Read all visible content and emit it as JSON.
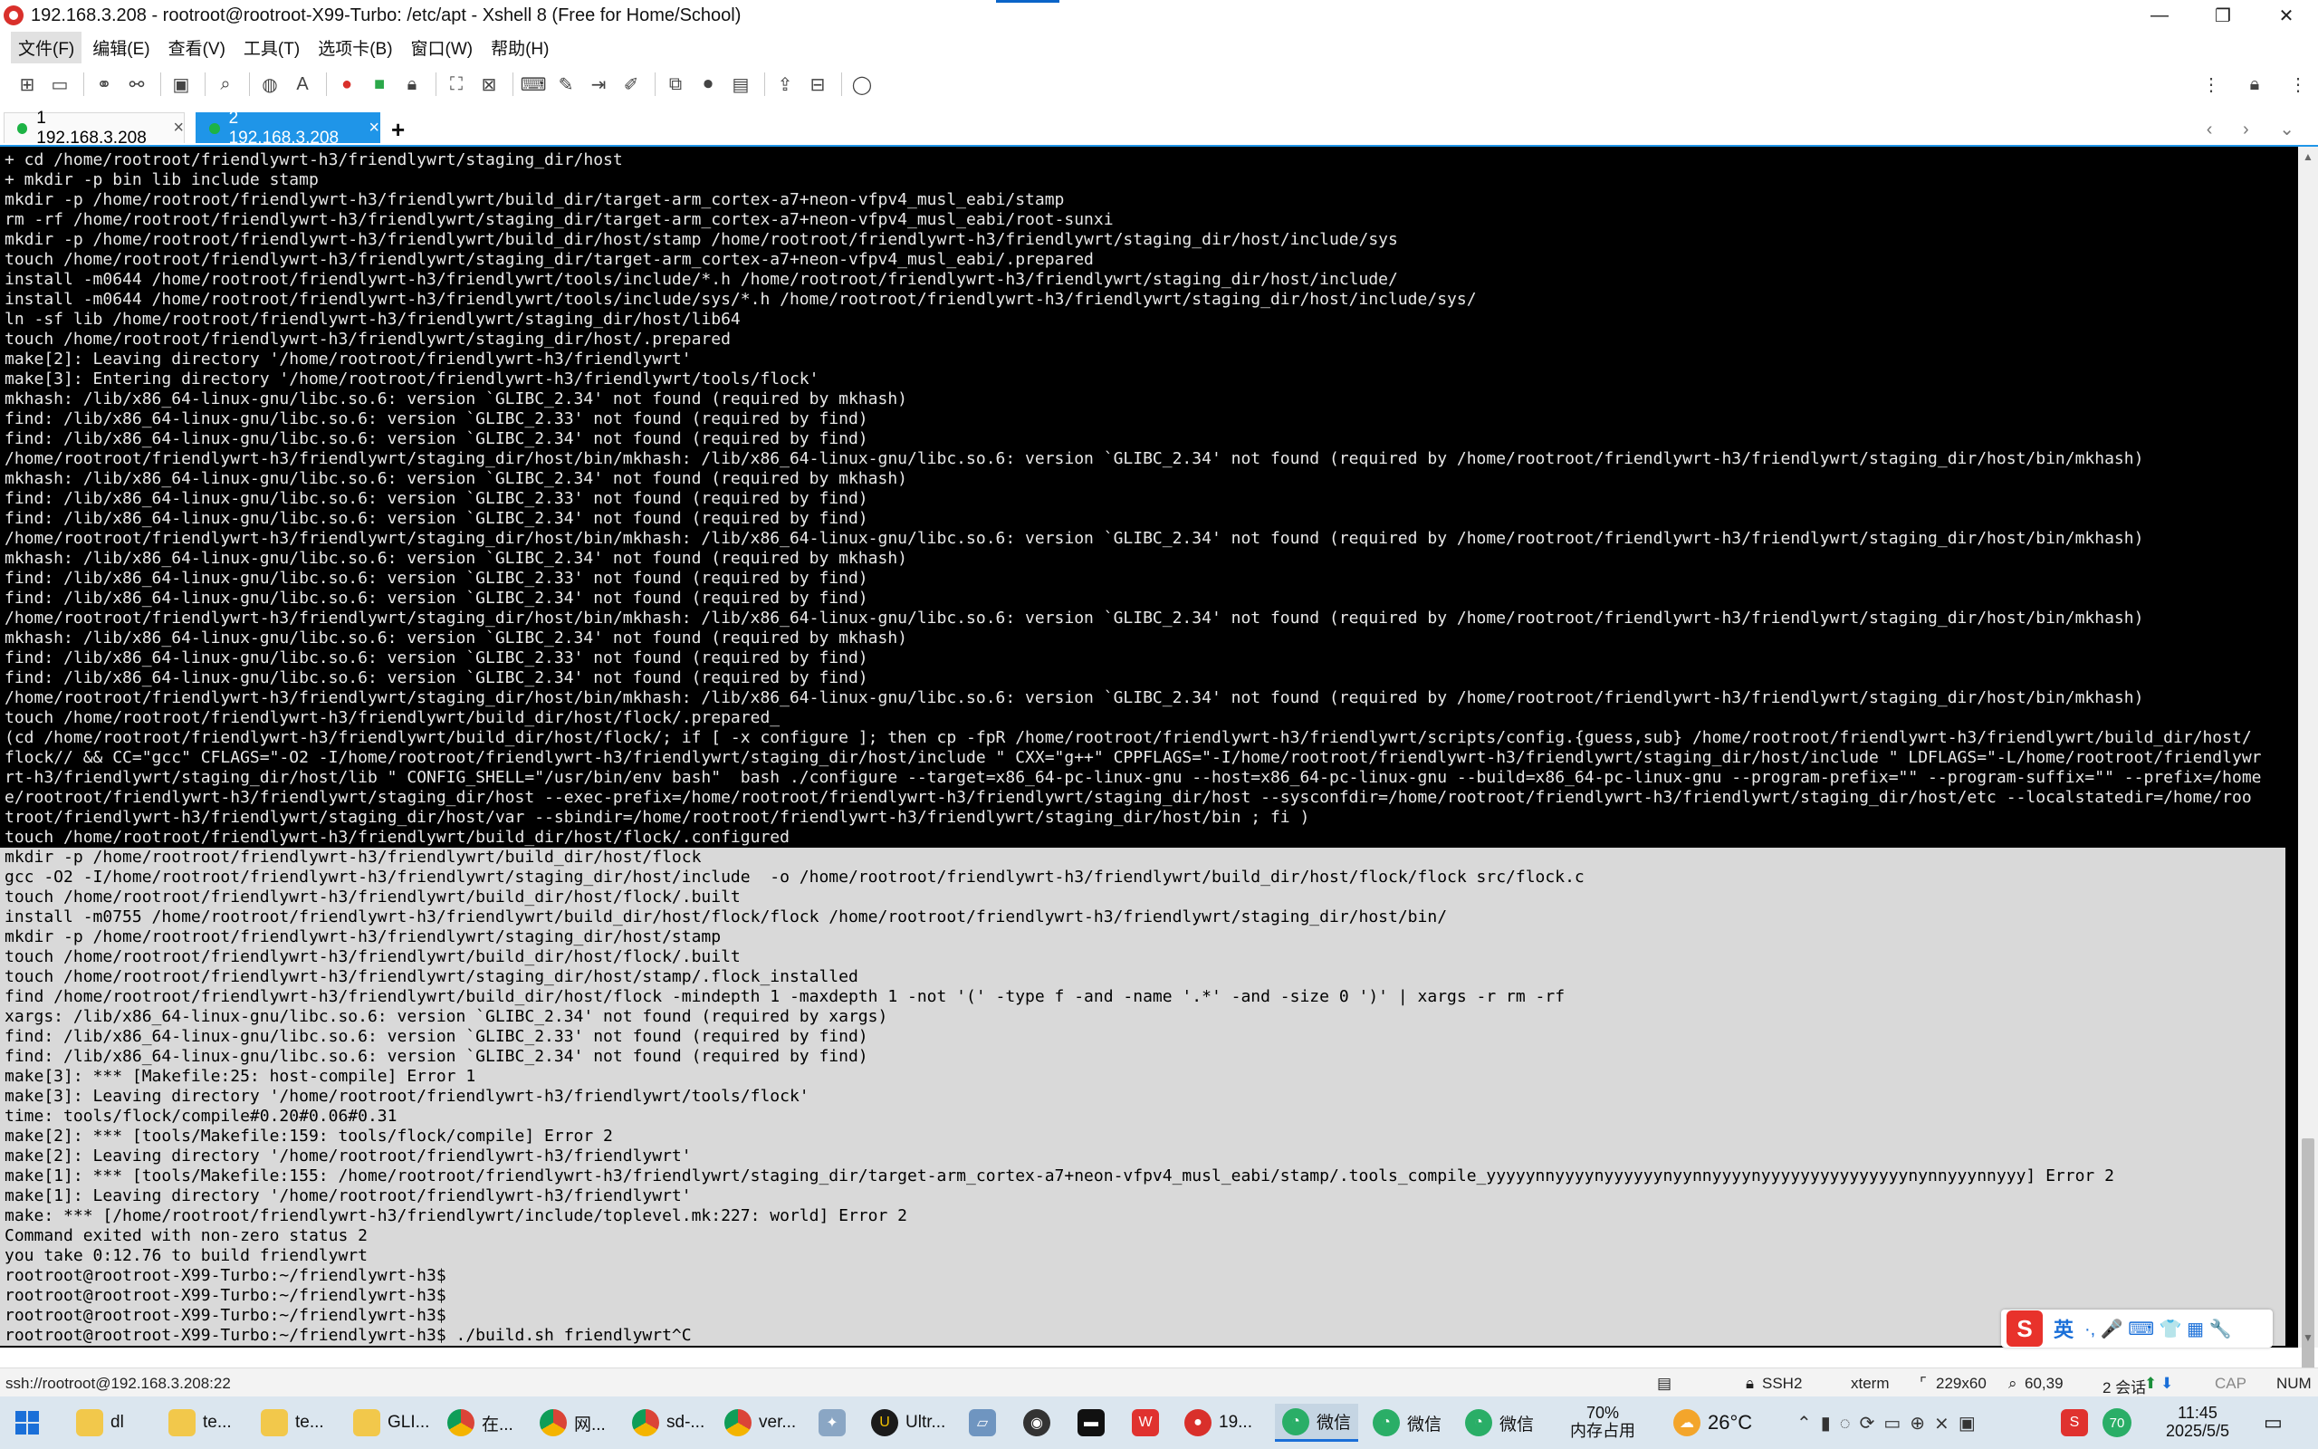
{
  "window": {
    "title": "192.168.3.208 - rootroot@rootroot-X99-Turbo: /etc/apt - Xshell 8 (Free for Home/School)",
    "controls": {
      "minimize": "—",
      "maximize": "❐",
      "close": "✕"
    }
  },
  "menu": [
    "文件(F)",
    "编辑(E)",
    "查看(V)",
    "工具(T)",
    "选项卡(B)",
    "窗口(W)",
    "帮助(H)"
  ],
  "tabs": [
    {
      "label": "1 192.168.3.208",
      "close": "×",
      "active": false
    },
    {
      "label": "2 192.168.3.208",
      "close": "×",
      "active": true
    }
  ],
  "tab_add": "+",
  "tab_nav": "‹ › ⌄",
  "terminal": {
    "lines": [
      "+ cd /home/rootroot/friendlywrt-h3/friendlywrt/staging_dir/host",
      "+ mkdir -p bin lib include stamp",
      "mkdir -p /home/rootroot/friendlywrt-h3/friendlywrt/build_dir/target-arm_cortex-a7+neon-vfpv4_musl_eabi/stamp",
      "rm -rf /home/rootroot/friendlywrt-h3/friendlywrt/staging_dir/target-arm_cortex-a7+neon-vfpv4_musl_eabi/root-sunxi",
      "mkdir -p /home/rootroot/friendlywrt-h3/friendlywrt/build_dir/host/stamp /home/rootroot/friendlywrt-h3/friendlywrt/staging_dir/host/include/sys",
      "touch /home/rootroot/friendlywrt-h3/friendlywrt/staging_dir/target-arm_cortex-a7+neon-vfpv4_musl_eabi/.prepared",
      "install -m0644 /home/rootroot/friendlywrt-h3/friendlywrt/tools/include/*.h /home/rootroot/friendlywrt-h3/friendlywrt/staging_dir/host/include/",
      "install -m0644 /home/rootroot/friendlywrt-h3/friendlywrt/tools/include/sys/*.h /home/rootroot/friendlywrt-h3/friendlywrt/staging_dir/host/include/sys/",
      "ln -sf lib /home/rootroot/friendlywrt-h3/friendlywrt/staging_dir/host/lib64",
      "touch /home/rootroot/friendlywrt-h3/friendlywrt/staging_dir/host/.prepared",
      "make[2]: Leaving directory '/home/rootroot/friendlywrt-h3/friendlywrt'",
      "make[3]: Entering directory '/home/rootroot/friendlywrt-h3/friendlywrt/tools/flock'",
      "mkhash: /lib/x86_64-linux-gnu/libc.so.6: version `GLIBC_2.34' not found (required by mkhash)",
      "find: /lib/x86_64-linux-gnu/libc.so.6: version `GLIBC_2.33' not found (required by find)",
      "find: /lib/x86_64-linux-gnu/libc.so.6: version `GLIBC_2.34' not found (required by find)",
      "/home/rootroot/friendlywrt-h3/friendlywrt/staging_dir/host/bin/mkhash: /lib/x86_64-linux-gnu/libc.so.6: version `GLIBC_2.34' not found (required by /home/rootroot/friendlywrt-h3/friendlywrt/staging_dir/host/bin/mkhash)",
      "mkhash: /lib/x86_64-linux-gnu/libc.so.6: version `GLIBC_2.34' not found (required by mkhash)",
      "find: /lib/x86_64-linux-gnu/libc.so.6: version `GLIBC_2.33' not found (required by find)",
      "find: /lib/x86_64-linux-gnu/libc.so.6: version `GLIBC_2.34' not found (required by find)",
      "/home/rootroot/friendlywrt-h3/friendlywrt/staging_dir/host/bin/mkhash: /lib/x86_64-linux-gnu/libc.so.6: version `GLIBC_2.34' not found (required by /home/rootroot/friendlywrt-h3/friendlywrt/staging_dir/host/bin/mkhash)",
      "mkhash: /lib/x86_64-linux-gnu/libc.so.6: version `GLIBC_2.34' not found (required by mkhash)",
      "find: /lib/x86_64-linux-gnu/libc.so.6: version `GLIBC_2.33' not found (required by find)",
      "find: /lib/x86_64-linux-gnu/libc.so.6: version `GLIBC_2.34' not found (required by find)",
      "/home/rootroot/friendlywrt-h3/friendlywrt/staging_dir/host/bin/mkhash: /lib/x86_64-linux-gnu/libc.so.6: version `GLIBC_2.34' not found (required by /home/rootroot/friendlywrt-h3/friendlywrt/staging_dir/host/bin/mkhash)",
      "mkhash: /lib/x86_64-linux-gnu/libc.so.6: version `GLIBC_2.34' not found (required by mkhash)",
      "find: /lib/x86_64-linux-gnu/libc.so.6: version `GLIBC_2.33' not found (required by find)",
      "find: /lib/x86_64-linux-gnu/libc.so.6: version `GLIBC_2.34' not found (required by find)",
      "/home/rootroot/friendlywrt-h3/friendlywrt/staging_dir/host/bin/mkhash: /lib/x86_64-linux-gnu/libc.so.6: version `GLIBC_2.34' not found (required by /home/rootroot/friendlywrt-h3/friendlywrt/staging_dir/host/bin/mkhash)",
      "touch /home/rootroot/friendlywrt-h3/friendlywrt/build_dir/host/flock/.prepared_",
      "(cd /home/rootroot/friendlywrt-h3/friendlywrt/build_dir/host/flock/; if [ -x configure ]; then cp -fpR /home/rootroot/friendlywrt-h3/friendlywrt/scripts/config.{guess,sub} /home/rootroot/friendlywrt-h3/friendlywrt/build_dir/host/",
      "flock// && CC=\"gcc\" CFLAGS=\"-O2 -I/home/rootroot/friendlywrt-h3/friendlywrt/staging_dir/host/include \" CXX=\"g++\" CPPFLAGS=\"-I/home/rootroot/friendlywrt-h3/friendlywrt/staging_dir/host/include \" LDFLAGS=\"-L/home/rootroot/friendlywr",
      "rt-h3/friendlywrt/staging_dir/host/lib \" CONFIG_SHELL=\"/usr/bin/env bash\"  bash ./configure --target=x86_64-pc-linux-gnu --host=x86_64-pc-linux-gnu --build=x86_64-pc-linux-gnu --program-prefix=\"\" --program-suffix=\"\" --prefix=/home",
      "e/rootroot/friendlywrt-h3/friendlywrt/staging_dir/host --exec-prefix=/home/rootroot/friendlywrt-h3/friendlywrt/staging_dir/host --sysconfdir=/home/rootroot/friendlywrt-h3/friendlywrt/staging_dir/host/etc --localstatedir=/home/roo",
      "troot/friendlywrt-h3/friendlywrt/staging_dir/host/var --sbindir=/home/rootroot/friendlywrt-h3/friendlywrt/staging_dir/host/bin ; fi )",
      "touch /home/rootroot/friendlywrt-h3/friendlywrt/build_dir/host/flock/.configured"
    ],
    "selected_lines": [
      "mkdir -p /home/rootroot/friendlywrt-h3/friendlywrt/build_dir/host/flock",
      "gcc -O2 -I/home/rootroot/friendlywrt-h3/friendlywrt/staging_dir/host/include  -o /home/rootroot/friendlywrt-h3/friendlywrt/build_dir/host/flock/flock src/flock.c",
      "touch /home/rootroot/friendlywrt-h3/friendlywrt/build_dir/host/flock/.built",
      "install -m0755 /home/rootroot/friendlywrt-h3/friendlywrt/build_dir/host/flock/flock /home/rootroot/friendlywrt-h3/friendlywrt/staging_dir/host/bin/",
      "mkdir -p /home/rootroot/friendlywrt-h3/friendlywrt/staging_dir/host/stamp",
      "touch /home/rootroot/friendlywrt-h3/friendlywrt/build_dir/host/flock/.built",
      "touch /home/rootroot/friendlywrt-h3/friendlywrt/staging_dir/host/stamp/.flock_installed",
      "find /home/rootroot/friendlywrt-h3/friendlywrt/build_dir/host/flock -mindepth 1 -maxdepth 1 -not '(' -type f -and -name '.*' -and -size 0 ')' | xargs -r rm -rf",
      "xargs: /lib/x86_64-linux-gnu/libc.so.6: version `GLIBC_2.34' not found (required by xargs)",
      "find: /lib/x86_64-linux-gnu/libc.so.6: version `GLIBC_2.33' not found (required by find)",
      "find: /lib/x86_64-linux-gnu/libc.so.6: version `GLIBC_2.34' not found (required by find)",
      "make[3]: *** [Makefile:25: host-compile] Error 1",
      "make[3]: Leaving directory '/home/rootroot/friendlywrt-h3/friendlywrt/tools/flock'",
      "time: tools/flock/compile#0.20#0.06#0.31",
      "make[2]: *** [tools/Makefile:159: tools/flock/compile] Error 2",
      "make[2]: Leaving directory '/home/rootroot/friendlywrt-h3/friendlywrt'",
      "make[1]: *** [tools/Makefile:155: /home/rootroot/friendlywrt-h3/friendlywrt/staging_dir/target-arm_cortex-a7+neon-vfpv4_musl_eabi/stamp/.tools_compile_yyyyynnyyyynyyyyyynyynnyyyynyyyyyyyyyyyyyyynynnyyynnyyy] Error 2",
      "make[1]: Leaving directory '/home/rootroot/friendlywrt-h3/friendlywrt'",
      "make: *** [/home/rootroot/friendlywrt-h3/friendlywrt/include/toplevel.mk:227: world] Error 2",
      "Command exited with non-zero status 2",
      "you take 0:12.76 to build friendlywrt",
      "rootroot@rootroot-X99-Turbo:~/friendlywrt-h3$",
      "rootroot@rootroot-X99-Turbo:~/friendlywrt-h3$",
      "rootroot@rootroot-X99-Turbo:~/friendlywrt-h3$",
      "rootroot@rootroot-X99-Turbo:~/friendlywrt-h3$ ./build.sh friendlywrt^C"
    ]
  },
  "ime": {
    "logo": "S",
    "mode": "英",
    "icons": "·, 🎤 ⌨ 👕 ▦ 🔧"
  },
  "statusbar": {
    "address": "ssh://rootroot@192.168.3.208:22",
    "protocol": "SSH2",
    "term": "xterm",
    "size": "229x60",
    "cursor": "60,39",
    "sessions": "2 会话",
    "caps": "CAP",
    "num": "NUM"
  },
  "taskbar": {
    "items": [
      {
        "label": "dl",
        "kind": "folder"
      },
      {
        "label": "te...",
        "kind": "folder"
      },
      {
        "label": "te...",
        "kind": "folder"
      },
      {
        "label": "GLI...",
        "kind": "folder"
      },
      {
        "label": "在...",
        "kind": "chrome"
      },
      {
        "label": "网...",
        "kind": "chrome"
      },
      {
        "label": "sd-...",
        "kind": "chrome"
      },
      {
        "label": "ver...",
        "kind": "chrome"
      },
      {
        "label": "Ultr...",
        "kind": "ultra"
      },
      {
        "label": "19...",
        "kind": "xshell"
      },
      {
        "label": "微信",
        "kind": "wechat"
      },
      {
        "label": "微信",
        "kind": "wechat"
      },
      {
        "label": "微信",
        "kind": "wechat"
      }
    ],
    "memory_percent": "70%",
    "memory_label": "内存占用",
    "weather": "26°C",
    "tray_badge": "70",
    "time": "11:45",
    "date": "2025/5/5"
  }
}
